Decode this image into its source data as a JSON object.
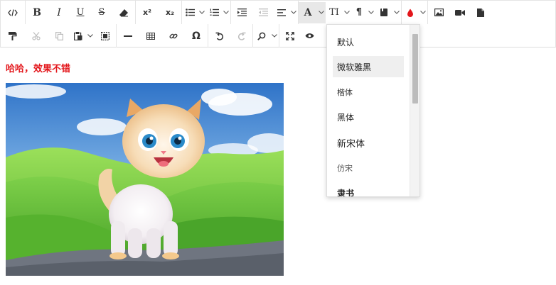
{
  "toolbar": {
    "row1": [
      {
        "name": "source-code-icon",
        "glyph": "</>"
      },
      {
        "name": "bold-icon",
        "glyph": "B"
      },
      {
        "name": "italic-icon",
        "glyph": "I"
      },
      {
        "name": "underline-icon",
        "glyph": "U"
      },
      {
        "name": "strikethrough-icon",
        "glyph": "S"
      },
      {
        "name": "eraser-icon"
      },
      {
        "name": "superscript-icon",
        "glyph": "x²"
      },
      {
        "name": "subscript-icon",
        "glyph": "x₂"
      },
      {
        "name": "bullet-list-icon"
      },
      {
        "name": "numbered-list-icon"
      },
      {
        "name": "indent-icon"
      },
      {
        "name": "outdent-icon"
      },
      {
        "name": "align-icon"
      },
      {
        "name": "font-family-icon",
        "glyph": "A"
      },
      {
        "name": "font-size-icon",
        "glyph": "TI"
      },
      {
        "name": "paragraph-icon",
        "glyph": "¶"
      },
      {
        "name": "bookmark-icon"
      },
      {
        "name": "font-color-icon"
      },
      {
        "name": "image-icon"
      },
      {
        "name": "video-icon"
      },
      {
        "name": "file-icon"
      }
    ],
    "row2": [
      {
        "name": "format-painter-icon"
      },
      {
        "name": "cut-icon"
      },
      {
        "name": "copy-icon"
      },
      {
        "name": "paste-icon"
      },
      {
        "name": "select-all-icon"
      },
      {
        "name": "horizontal-rule-icon"
      },
      {
        "name": "table-icon"
      },
      {
        "name": "link-icon"
      },
      {
        "name": "special-char-icon",
        "glyph": "Ω"
      },
      {
        "name": "undo-icon"
      },
      {
        "name": "redo-icon"
      },
      {
        "name": "find-icon"
      },
      {
        "name": "fullscreen-icon"
      },
      {
        "name": "preview-icon"
      }
    ],
    "font_color": "#e3161b"
  },
  "content": {
    "text": "哈哈，效果不错",
    "text_color": "#e3161b",
    "image_alt": "cartoon kitten on green hills"
  },
  "font_dropdown": {
    "items": [
      "默认",
      "微软雅黑",
      "楷体",
      "黑体",
      "新宋体",
      "仿宋",
      "隶书"
    ],
    "selected": "微软雅黑"
  }
}
